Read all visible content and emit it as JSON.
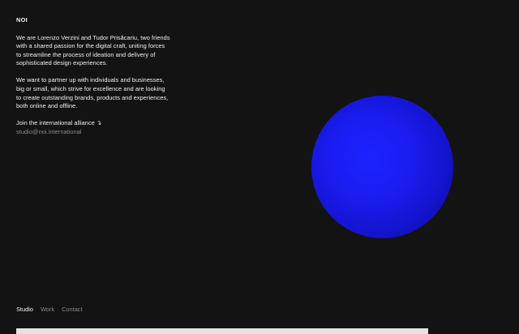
{
  "brand": "NOI",
  "intro": {
    "paragraph1": "We are Lorenzo Verzini and Tudor Prisăcariu, two friends with a shared passion for the digital craft, uniting forces to streamline the process of ideation and delivery of sophisticated design experiences.",
    "paragraph2": "We want to partner up with individuals and businesses, big or small, which strive for excellence and are looking to create outstanding brands, products and experiences, both online and offline.",
    "cta_label": "Join the international alliance ↴",
    "email": "studio@noi.international"
  },
  "visual": {
    "sphere_color": "#1a1de8"
  },
  "nav": {
    "studio": "Studio",
    "work": "Work",
    "contact": "Contact",
    "active": "Studio"
  }
}
